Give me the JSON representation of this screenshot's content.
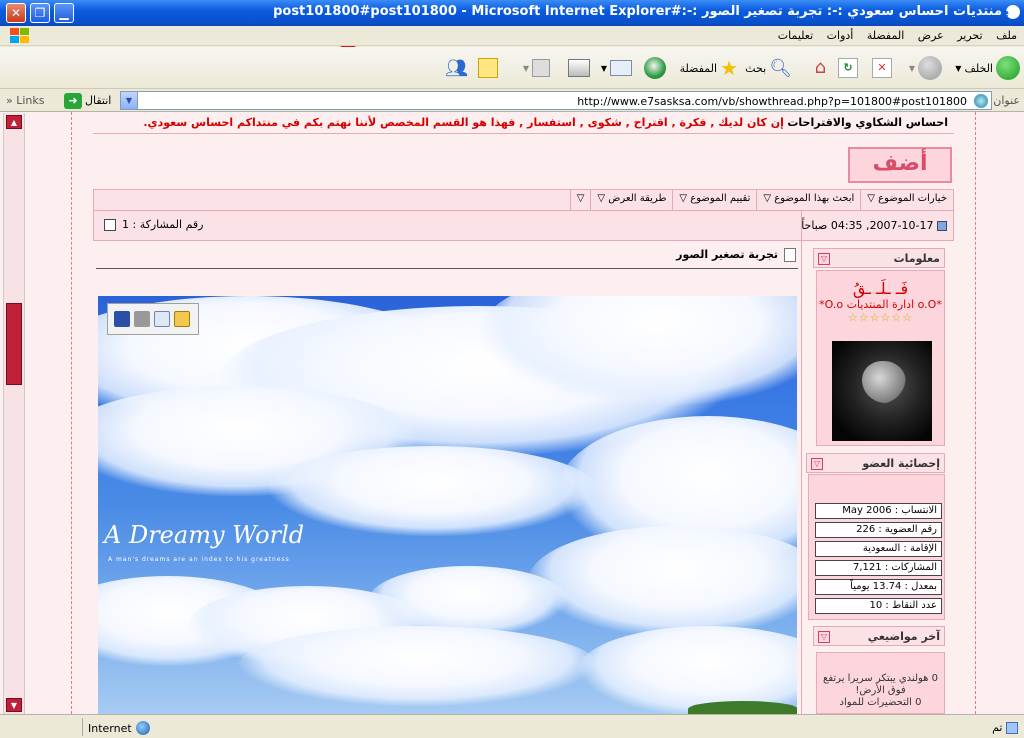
{
  "window": {
    "title": "post101800#post101800 - Microsoft Internet Explorer#:-: منتديات احساس سعودي :-: تجربة تصغير الصور"
  },
  "menu": [
    "ملف",
    "تحرير",
    "عرض",
    "المفضلة",
    "أدوات",
    "تعليمات"
  ],
  "toolbar": {
    "back_label": "الخلف",
    "search_label": "بحث",
    "favorites_label": "المفضلة"
  },
  "address": {
    "label": "عنوان",
    "url": "http://www.e7sasksa.com/vb/showthread.php?p=101800#post101800",
    "go_label": "انتقال",
    "links_label": "Links"
  },
  "forum": {
    "desc_title": "احساس الشكاوي والاقتراحات",
    "desc_text": "إن كان لديك , فكرة , اقتراح , شكوى , استفسار , فهذا هو القسم المخصص لأننا نهتم بكم في منتداكم احساس سعودي."
  },
  "add_button": "أضف",
  "thread_tools": [
    "خيارات الموضوع",
    "ابحث بهذا الموضوع",
    "تقييم الموضوع",
    "طريقة العرض"
  ],
  "post": {
    "date": "2007-10-17, 04:35 صباحاً",
    "number_label": "رقم المشاركة : 1",
    "title": "تجربة تصغير الصور",
    "image_title": "A Dreamy World",
    "image_subtitle": "A man's dreams are an index to his greatness"
  },
  "sidebar": {
    "info_head": "معلومات",
    "username": "فَـ ـلَـ ـقُ",
    "user_title": "*o.O ادارة المنتديات O.o*",
    "stars": "☆☆☆☆☆☆",
    "stats_head": "إحصائية العضو",
    "stats": [
      "الانتساب : May 2006",
      "رقم العضوية : 226",
      "الإقامة : السعودية",
      "المشاركات : 7,121",
      "بمعدل : 13.74 يومياً",
      "عدد النقاط : 10"
    ],
    "recent_head": "آخر مواضيعي",
    "recent": [
      "0 هولندي يبتكر سريرا يرتفع فوق الأرض!",
      "0 التحضيرات للمواد"
    ]
  },
  "status": {
    "done": "تم",
    "zone": "Internet"
  },
  "colors": {
    "accent": "#d40000",
    "page_bg": "#fdeef0",
    "panel": "#fbe2e7",
    "border": "#e6a9b8"
  }
}
